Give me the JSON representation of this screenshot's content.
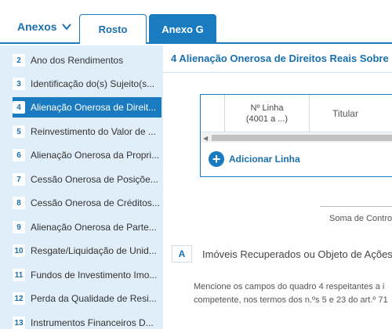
{
  "header": {
    "anexos_label": "Anexos",
    "tabs": [
      {
        "label": "Rosto"
      },
      {
        "label": "Anexo G"
      }
    ]
  },
  "sidebar": {
    "items": [
      {
        "num": "2",
        "label": "Ano dos Rendimentos"
      },
      {
        "num": "3",
        "label": "Identificação do(s) Sujeito(s..."
      },
      {
        "num": "4",
        "label": "Alienação Onerosa de Direit..."
      },
      {
        "num": "5",
        "label": "Reinvestimento do Valor de ..."
      },
      {
        "num": "6",
        "label": "Alienação Onerosa da Propri..."
      },
      {
        "num": "7",
        "label": "Cessão Onerosa de Posiçõe..."
      },
      {
        "num": "8",
        "label": "Cessão Onerosa de Créditos..."
      },
      {
        "num": "9",
        "label": "Alienação Onerosa de Parte..."
      },
      {
        "num": "10",
        "label": "Resgate/Liquidação de Unid..."
      },
      {
        "num": "11",
        "label": "Fundos de Investimento Imo..."
      },
      {
        "num": "12",
        "label": "Perda da Qualidade de Resi..."
      },
      {
        "num": "13",
        "label": "Instrumentos Financeiros D..."
      }
    ],
    "active_index": 2
  },
  "main": {
    "section_title": "4  Alienação Onerosa de Direitos Reais Sobre",
    "table": {
      "col_linha_line1": "Nº Linha",
      "col_linha_line2": "(4001 a ...)",
      "col_titular": "Titular"
    },
    "add_line_label": "Adicionar Linha",
    "soma_label": "Soma de Contro",
    "section_a": {
      "letter": "A",
      "title": "Imóveis Recuperados ou Objeto de Ações"
    },
    "paragraph_line1": "Mencione os campos do quadro 4 respeitantes a i",
    "paragraph_line2": "competente, nos termos dos n.ºs 5 e 23 do art.º 71"
  },
  "colors": {
    "accent": "#1a7bc0",
    "sidebar_bg": "#dfeef9",
    "link": "#1a6fae"
  }
}
